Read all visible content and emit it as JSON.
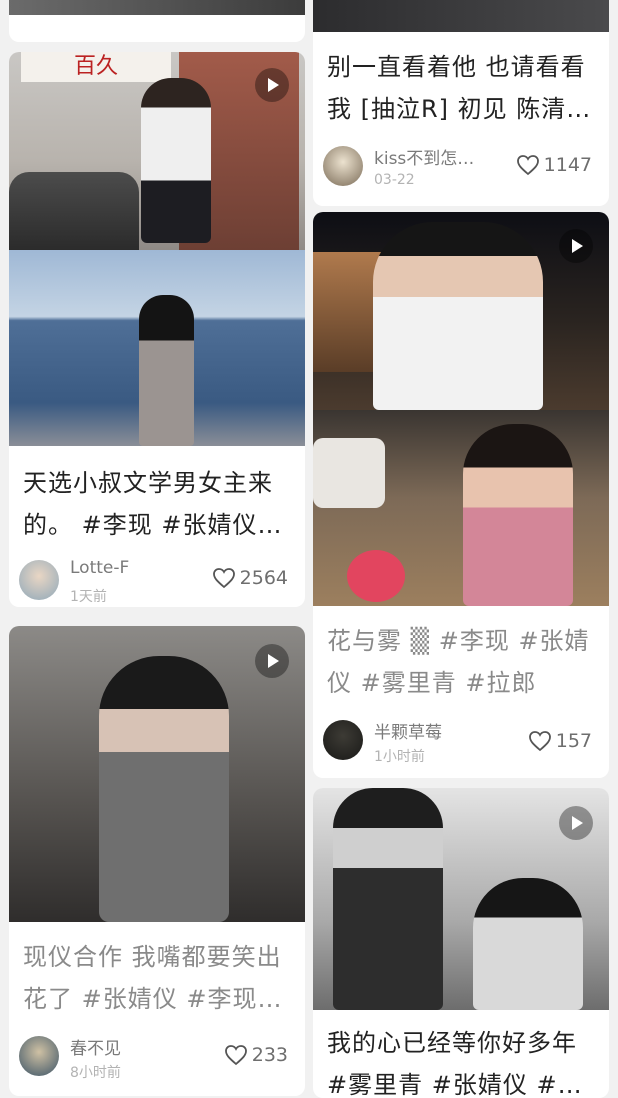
{
  "feed": {
    "left": [
      {
        "title": "天选小叔文学男女主来的。 #李现 #张婧仪 …",
        "author": "Lotte-F",
        "time": "1天前",
        "likes": "2564",
        "store_sign": "百久"
      },
      {
        "title": "现仪合作 我嘴都要笑出花了 #张婧仪 #李现 #…",
        "author": "春不见",
        "time": "8小时前",
        "likes": "233"
      }
    ],
    "right": [
      {
        "title": "别一直看着他 也请看看我 [抽泣R] 初见 陈清…",
        "author": "kiss不到怎…",
        "time": "03-22",
        "likes": "1147"
      },
      {
        "title": "花与雾 ▒ #李现 #张婧仪 #雾里青 #拉郎",
        "author": "半颗草莓",
        "time": "1小时前",
        "likes": "157"
      },
      {
        "title": "我的心已经等你好多年 #雾里青 #张婧仪 #李…",
        "author": "",
        "time": "",
        "likes": ""
      }
    ]
  },
  "icons": {
    "play": "play-icon",
    "like": "heart-icon"
  },
  "colors": {
    "background": "#f1f1f1",
    "card": "#ffffff",
    "text": "#222222",
    "meta": "#b3b3b3"
  }
}
